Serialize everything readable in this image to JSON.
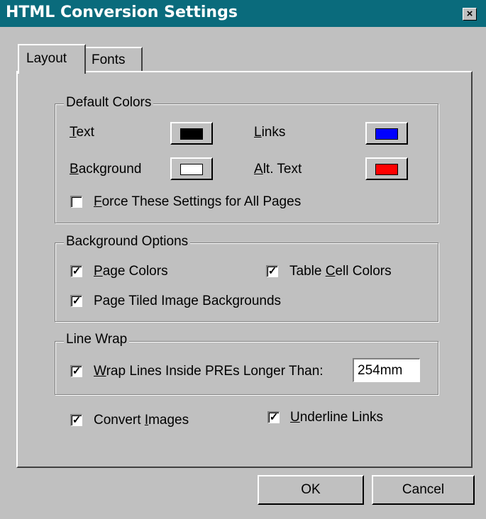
{
  "window": {
    "title": "HTML Conversion Settings",
    "close_glyph": "×"
  },
  "tabs": [
    {
      "label": "Layout",
      "active": true
    },
    {
      "label": "Fonts",
      "active": false
    }
  ],
  "default_colors": {
    "legend": "Default Colors",
    "text": {
      "label": "Text",
      "color": "#000000"
    },
    "links": {
      "label": "Links",
      "color": "#0000ff"
    },
    "background": {
      "label": "Background",
      "color": "#ffffff"
    },
    "alt_text": {
      "label": "Alt. Text",
      "color": "#ff0000"
    },
    "force": {
      "label": "Force These Settings for All Pages",
      "checked": false
    }
  },
  "background_options": {
    "legend": "Background Options",
    "page_colors": {
      "label": "Page Colors",
      "checked": true
    },
    "table_cell_colors": {
      "label": "Table Cell Colors",
      "checked": true
    },
    "tiled_backgrounds": {
      "label": "Page Tiled Image Backgrounds",
      "checked": true
    }
  },
  "line_wrap": {
    "legend": "Line Wrap",
    "wrap": {
      "label": "Wrap Lines Inside PREs Longer Than:",
      "checked": true
    },
    "value": "254mm"
  },
  "convert_images": {
    "label": "Convert Images",
    "checked": true
  },
  "underline_links": {
    "label": "Underline Links",
    "checked": true
  },
  "buttons": {
    "ok": "OK",
    "cancel": "Cancel"
  },
  "check_glyph": "✓"
}
